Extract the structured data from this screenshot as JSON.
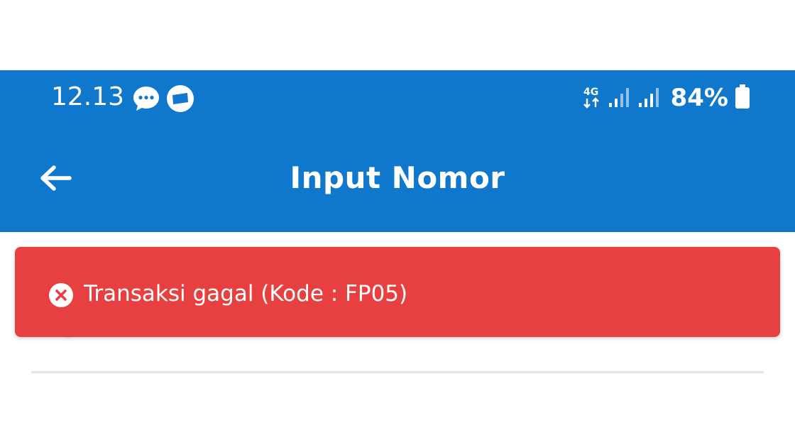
{
  "status_bar": {
    "time": "12.13",
    "network_type": "4G",
    "battery_percent": "84%",
    "icons": [
      "chat-bubble-icon",
      "message-app-icon",
      "data-arrows-icon",
      "signal-icon",
      "signal-icon",
      "battery-icon"
    ]
  },
  "toolbar": {
    "title": "Input Nomor",
    "back_icon": "arrow-left-icon"
  },
  "snackbar": {
    "icon": "error-circle-icon",
    "message": "Transaksi gagal (Kode : FP05)"
  },
  "colors": {
    "primary": "#1078CC",
    "error": "#E84040",
    "on_primary": "#FFFFFF",
    "divider": "#E6E6E6"
  }
}
